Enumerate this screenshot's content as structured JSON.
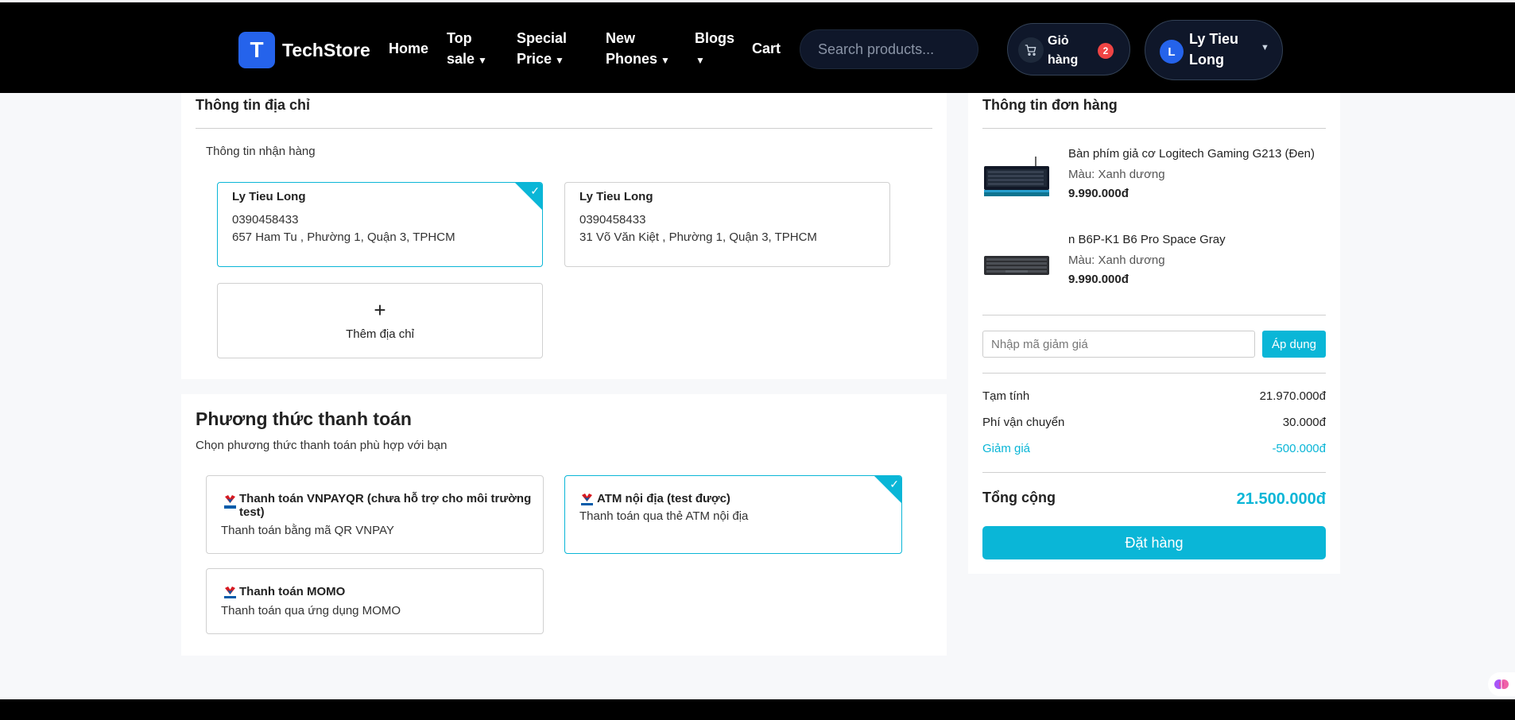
{
  "header": {
    "logo_letter": "T",
    "logo_text": "TechStore",
    "nav": {
      "home": "Home",
      "top_sale": [
        "Top",
        "sale"
      ],
      "special_price": [
        "Special",
        "Price"
      ],
      "new_phones": [
        "New",
        "Phones"
      ],
      "blogs": "Blogs",
      "cart": "Cart"
    },
    "search_placeholder": "Search products...",
    "cart_button": {
      "label": [
        "Giỏ",
        "hàng"
      ],
      "badge": "2"
    },
    "user": {
      "initial": "L",
      "name": [
        "Ly Tieu",
        "Long"
      ]
    }
  },
  "address_section": {
    "title": "Thông tin địa chỉ",
    "subtitle": "Thông tin nhận hàng",
    "addresses": [
      {
        "name": "Ly Tieu Long",
        "phone": "0390458433",
        "address": "657 Ham Tu , Phường 1, Quận 3, TPHCM",
        "selected": true
      },
      {
        "name": "Ly Tieu Long",
        "phone": "0390458433",
        "address": "31 Võ Văn Kiệt , Phường 1, Quận 3, TPHCM",
        "selected": false
      }
    ],
    "add_label": "Thêm địa chỉ"
  },
  "payment_section": {
    "title": "Phương thức thanh toán",
    "subtitle": "Chọn phương thức thanh toán phù hợp với bạn",
    "methods": [
      {
        "name_lines": [
          "Thanh toán VNPAYQR (chưa hỗ trợ cho môi trường",
          "test)"
        ],
        "desc": "Thanh toán bằng mã QR VNPAY",
        "selected": false
      },
      {
        "name_lines": [
          "ATM nội địa (test được)"
        ],
        "desc": "Thanh toán qua thẻ ATM nội địa",
        "selected": true
      },
      {
        "name_lines": [
          "Thanh toán MOMO"
        ],
        "desc": "Thanh toán qua ứng dụng MOMO",
        "selected": false
      }
    ]
  },
  "order_section": {
    "title": "Thông tin đơn hàng",
    "products": [
      {
        "name": "Bàn phím giả cơ Logitech Gaming G213 (Đen)",
        "variant": "Màu: Xanh dương",
        "price": "9.990.000đ"
      },
      {
        "name": "n B6P-K1 B6 Pro Space Gray",
        "variant": "Màu: Xanh dương",
        "price": "9.990.000đ"
      }
    ],
    "coupon_placeholder": "Nhập mã giảm giá",
    "apply_label": "Áp dụng",
    "subtotal_label": "Tạm tính",
    "subtotal_value": "21.970.000đ",
    "shipping_label": "Phí vận chuyển",
    "shipping_value": "30.000đ",
    "discount_label": "Giảm giá",
    "discount_value": "-500.000đ",
    "total_label": "Tổng cộng",
    "total_value": "21.500.000đ",
    "order_button": "Đặt hàng"
  },
  "colors": {
    "accent": "#0ab6d7",
    "header_bg": "#000000",
    "logo_blue": "#2563eb",
    "badge_red": "#ef4444"
  },
  "icons": [
    "logo-icon",
    "cart-icon",
    "caret-down-icon",
    "check-icon",
    "plus-icon",
    "vnpay-logo",
    "keyboard-image",
    "extension-icon"
  ]
}
